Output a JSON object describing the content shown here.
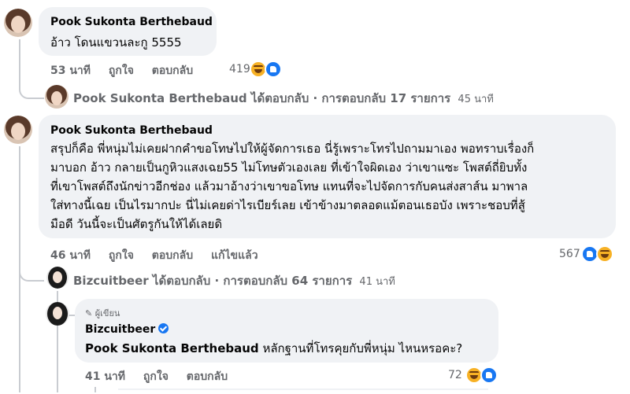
{
  "comment1": {
    "author": "Pook Sukonta Berthebaud",
    "text": "อ้าว โดนแขวนละกู 5555",
    "time": "53 นาที",
    "like": "ถูกใจ",
    "reply": "ตอบกลับ",
    "reaction_count": "419",
    "replies_summary": {
      "name": "Pook Sukonta Berthebaud",
      "label": "ได้ตอบกลับ · การตอบกลับ 17 รายการ",
      "time": "45 นาที"
    }
  },
  "comment2": {
    "author": "Pook Sukonta Berthebaud",
    "lines": [
      "สรุปก็คือ พี่หนุ่มไม่เคยฝากคำขอโทษไปให้ผู้จัดการเธอ นี่รู้เพราะโทรไปถามมาเอง พอทราบเรื่องก็",
      "มาบอก อ้าว กลายเป็นกูหิวแสงเฉย55 ไม่โทษตัวเองเลย ที่เข้าใจผิดเอง ว่าเขาแซะ โพสต์ถี่ยิบทั้ง",
      "ที่เขาโพสต์ถึงนักข่าวอีกช่อง แล้วมาอ้างว่าเขาขอโทษ แทนที่จะไปจัดการกับคนส่งสาส์น มาพาล",
      "ใส่ทางนี้เฉย เป็นไรมากปะ นี่ไม่เคยด่าไรเบียร์เลย เข้าข้างมาตลอดแม้ตอนเธอบัง เพราะชอบที่สู้",
      "มือดี วันนี้จะเป็นศัตรูกันให้ได้เลยดิ"
    ],
    "time": "46 นาที",
    "like": "ถูกใจ",
    "reply": "ตอบกลับ",
    "edited": "แก้ไขแล้ว",
    "reaction_count": "567",
    "replies_summary": {
      "name": "Bizcuitbeer",
      "label": "ได้ตอบกลับ · การตอบกลับ 64 รายการ",
      "time": "41 นาที"
    }
  },
  "reply1": {
    "author_tag": "ผู้เขียน",
    "author": "Bizcuitbeer",
    "mention": "Pook Sukonta Berthebaud",
    "text": " หลักฐานที่โทรคุยกับพี่หนุ่ม ไหนหรอคะ?",
    "time": "41 นาที",
    "like": "ถูกใจ",
    "reply": "ตอบกลับ",
    "reaction_count": "72"
  },
  "colors": {
    "bubble": "#f0f2f5",
    "meta": "#65676b",
    "like_blue": "#1877f2",
    "haha_yellow": "#f7b125"
  }
}
